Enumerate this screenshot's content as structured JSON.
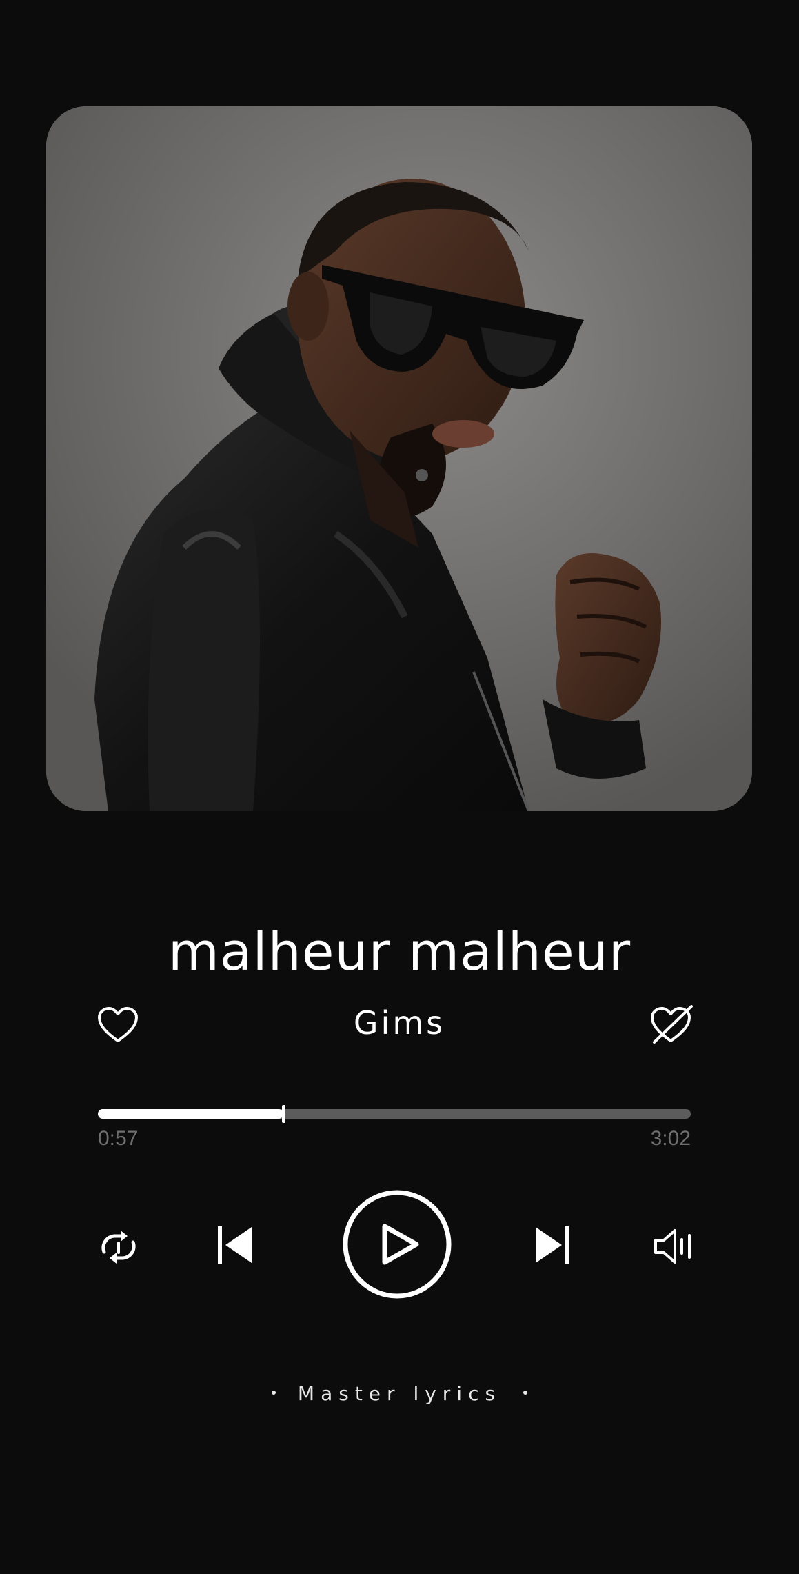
{
  "track": {
    "title": "malheur malheur",
    "artist": "Gims",
    "liked": false,
    "artwork": "album-art-photo"
  },
  "progress": {
    "current_time": "0:57",
    "total_time": "3:02",
    "fraction": 0.313
  },
  "controls": {
    "like_icon": "heart-outline-icon",
    "dislike_icon": "heart-crossed-icon",
    "repeat_icon": "repeat-icon",
    "previous_icon": "skip-previous-icon",
    "play_icon": "play-icon",
    "next_icon": "skip-next-icon",
    "volume_icon": "volume-icon"
  },
  "footer": {
    "label": "Master lyrics"
  },
  "colors": {
    "background": "#0c0c0c",
    "foreground": "#ffffff",
    "track_inactive": "#5c5c5c",
    "time_text": "#6f6f6f"
  }
}
